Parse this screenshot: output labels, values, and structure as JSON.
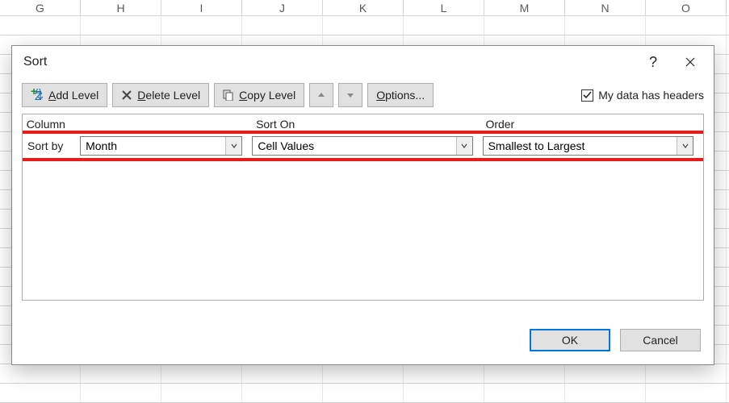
{
  "columns": [
    "G",
    "H",
    "I",
    "J",
    "K",
    "L",
    "M",
    "N",
    "O"
  ],
  "dialog": {
    "title": "Sort",
    "help": "?",
    "toolbar": {
      "add_pre": "A",
      "add_post": "dd Level",
      "del_pre": "D",
      "del_post": "elete Level",
      "copy_pre": "C",
      "copy_post": "opy Level",
      "options_pre": "O",
      "options_post": "ptions...",
      "headers_pre": "My data has ",
      "headers_ul": "h",
      "headers_post": "eaders"
    },
    "headers": {
      "column": "Column",
      "sort_on": "Sort On",
      "order": "Order"
    },
    "level": {
      "label": "Sort by",
      "column": "Month",
      "sort_on": "Cell Values",
      "order": "Smallest to Largest"
    },
    "footer": {
      "ok": "OK",
      "cancel": "Cancel"
    }
  }
}
